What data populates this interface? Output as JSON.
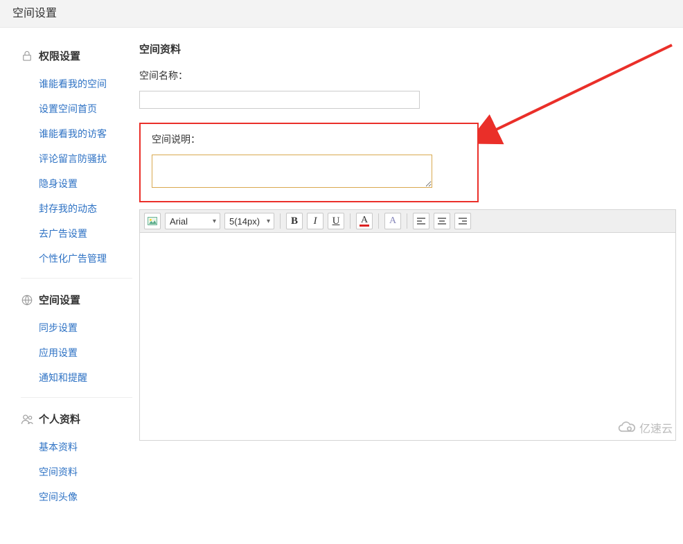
{
  "header": {
    "title": "空间设置"
  },
  "sidebar": {
    "sections": [
      {
        "title": "权限设置",
        "items": [
          "谁能看我的空间",
          "设置空间首页",
          "谁能看我的访客",
          "评论留言防骚扰",
          "隐身设置",
          "封存我的动态",
          "去广告设置",
          "个性化广告管理"
        ]
      },
      {
        "title": "空间设置",
        "items": [
          "同步设置",
          "应用设置",
          "通知和提醒"
        ]
      },
      {
        "title": "个人资料",
        "items": [
          "基本资料",
          "空间资料",
          "空间头像"
        ]
      }
    ]
  },
  "main": {
    "title": "空间资料",
    "name_label": "空间名称：",
    "name_value": "",
    "desc_label": "空间说明：",
    "desc_value": ""
  },
  "toolbar": {
    "font": "Arial",
    "size": "5(14px)",
    "bold": "B",
    "italic": "I",
    "underline": "U",
    "color": "A",
    "clear": "A"
  },
  "watermark": {
    "text": "亿速云"
  }
}
